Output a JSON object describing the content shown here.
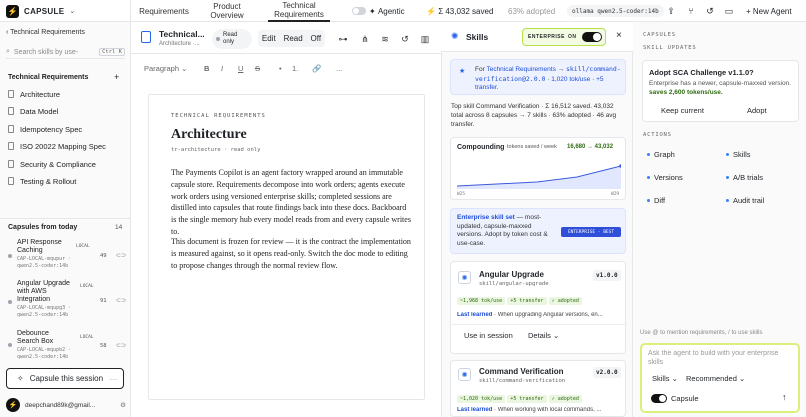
{
  "app": {
    "brand": "CAPSULE"
  },
  "nav": {
    "tabs": [
      "Requirements",
      "Product Overview",
      "Technical Requirements"
    ]
  },
  "topbar": {
    "agentic_label": "Agentic",
    "saved": "Σ 43,032 saved",
    "adopted": "63% adopted",
    "model": "ollama qwen2.5-coder:14b",
    "new_agent": "+ New Agent"
  },
  "sidebar": {
    "back": "Technical Requirements",
    "search_placeholder": "Search skills by use-",
    "search_kbd": "Ctrl K",
    "section": "Technical Requirements",
    "items": [
      "Architecture",
      "Data Model",
      "Idempotency Spec",
      "ISO 20022 Mapping Spec",
      "Security & Compliance",
      "Testing & Rollout"
    ],
    "capsules_heading": "Capsules from today",
    "capsules_count": "14",
    "capsules": [
      {
        "title": "API Response Caching",
        "badge": "LOCAL",
        "meta": "CAP-LOCAL-mqupur · qwen2.5-coder:14b",
        "n": "49"
      },
      {
        "title": "Angular Upgrade with AWS Integration",
        "badge": "LOCAL",
        "meta": "CAP-LOCAL-mqupg3 · qwen2.5-coder:14b",
        "n": "91"
      },
      {
        "title": "Debounce Search Box",
        "badge": "LOCAL",
        "meta": "CAP-LOCAL-mqupb2 · qwen2.5-coder:14b",
        "n": "58"
      }
    ],
    "capsule_btn": "Capsule this session",
    "user": "deepchand89k@gmail..."
  },
  "doc": {
    "title": "Technical...",
    "breadcrumb": "Architecture ·...",
    "readonly": "Read only",
    "modes": [
      "Edit",
      "Read",
      "Off"
    ],
    "paragraph": "Paragraph",
    "fmt": [
      "B",
      "I",
      "U",
      "S",
      "•",
      "1.",
      "🔗",
      "..."
    ],
    "eyebrow": "TECHNICAL REQUIREMENTS",
    "h1": "Architecture",
    "sub": "tr-architecture · read only",
    "p1": "The Payments Copilot is an agent factory wrapped around an immutable capsule store. Requirements decompose into work orders; agents execute work orders using versioned enterprise skills; completed sessions are distilled into capsules that route findings back into these docs. Backboard is the single memory hub every model reads from and every capsule writes to.",
    "p2": "This document is frozen for review — it is the contract the implementation is measured against, so it opens read-only. Switch the doc mode to editing to propose changes through the normal review flow."
  },
  "skills": {
    "title": "Skills",
    "enterprise": "ENTERPRISE",
    "on": "ON",
    "info_prefix": "For",
    "info_link": "Technical Requirements",
    "info_skill": "skill/command-verification@2.0.0",
    "info_rate": "1,020 tok/use",
    "info_tail": "+5 transfer.",
    "summary": "Top skill Command Verification · Σ 16,512 saved. 43,032 total across 8 capsules → 7 skills · 63% adopted · 46 avg transfer.",
    "compounding": "Compounding",
    "comp_unit": "tokens saved / week",
    "comp_vals": "16,680 → 43,032",
    "w_start": "W25",
    "w_end": "W29",
    "ent_set": "Enterprise skill set",
    "ent_text": "— most-updated, capsule-maxxed versions. Adopt by token cost & use-case.",
    "ent_badge": "ENTERPRISE · BEST",
    "cards": [
      {
        "name": "Angular Upgrade",
        "path": "skill/angular-upgrade",
        "ver": "v1.0.0",
        "chips": [
          "~1,968 tok/use",
          "+5 transfer",
          "✓ adopted"
        ],
        "learned": "Last learned",
        "learned_text": "· When upgrading Angular versions, en...",
        "actions": [
          "Use in session",
          "Details"
        ]
      },
      {
        "name": "Command Verification",
        "path": "skill/command-verification",
        "ver": "v2.0.0",
        "chips": [
          "~1,020 tok/use",
          "+5 transfer",
          "✓ adopted"
        ],
        "learned": "Last learned",
        "learned_text": "· When working with local commands, ..."
      }
    ]
  },
  "right": {
    "capsules_h": "CAPSULES",
    "updates_h": "SKILL UPDATES",
    "update_title": "Adopt SCA Challenge v1.1.0?",
    "update_text": "Enterprise has a newer, capsule-maxxed version.",
    "update_save": "saves 2,600 tokens/use.",
    "keep": "Keep current",
    "adopt": "Adopt",
    "actions_h": "ACTIONS",
    "actions": [
      "Graph",
      "Skills",
      "Versions",
      "A/B trials",
      "Diff",
      "Audit trail"
    ],
    "hint": "Use @ to mention requirements, / to use skills",
    "composer_placeholder": "Ask the agent to build with your enterprise skills",
    "skills_dd": "Skills",
    "recommended_dd": "Recommended",
    "capsule_toggle": "Capsule"
  },
  "colors": {
    "accent_green": "#b8e04a",
    "link_blue": "#1d4ed8",
    "adopt_green": "#2f6b12"
  }
}
